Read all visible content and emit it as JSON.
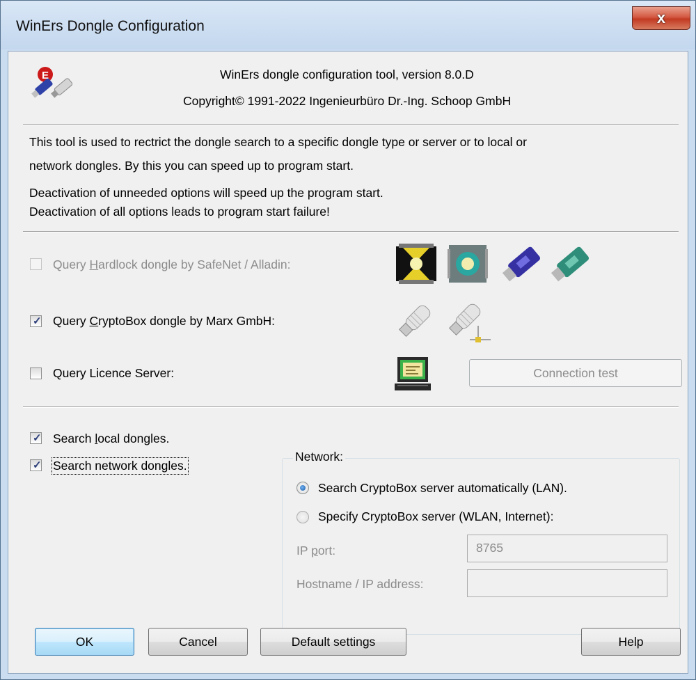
{
  "window": {
    "title": "WinErs Dongle Configuration",
    "close_glyph": "x"
  },
  "header": {
    "app_icon": "winers-dongle-logo-icon",
    "line1": "WinErs dongle configuration tool, version 8.0.D",
    "line2": "Copyright© 1991-2022 Ingenieurbüro Dr.-Ing. Schoop GmbH"
  },
  "info": {
    "para1_line1": "This tool is used to rectrict the dongle search to a specific dongle type or server or to local or",
    "para1_line2": "network dongles. By this you can speed up to program start.",
    "para2_line1": "Deactivation of unneeded options will speed up the program start.",
    "para2_line2": "Deactivation of all options leads to program start failure!"
  },
  "options": {
    "hardlock": {
      "label_pre": "Query ",
      "accel": "H",
      "label_post": "ardlock dongle by SafeNet / Alladin:",
      "checked": false,
      "enabled": false
    },
    "cryptobox": {
      "label_pre": "Query ",
      "accel": "C",
      "label_post": "ryptoBox dongle by Marx GmbH:",
      "checked": true,
      "enabled": true
    },
    "licence_server": {
      "label": "Query Licence Server:",
      "checked": false,
      "enabled": true
    },
    "connection_test": "Connection test"
  },
  "search": {
    "local": {
      "label_pre": "Search ",
      "accel": "l",
      "label_post": "ocal dongles.",
      "checked": true
    },
    "network": {
      "label": "Search network dongles.",
      "checked": true
    }
  },
  "network": {
    "group_label": "Network:",
    "radio_auto": {
      "label": "Search CryptoBox server automatically (LAN).",
      "selected": true
    },
    "radio_specify": {
      "label": "Specify CryptoBox server (WLAN, Internet):",
      "selected": false
    },
    "ip_port_pre": "IP ",
    "ip_port_accel": "p",
    "ip_port_post": "ort:",
    "ip_port_value": "8765",
    "hostname_label": "Hostname / IP address:",
    "hostname_value": ""
  },
  "buttons": {
    "ok": "OK",
    "cancel": "Cancel",
    "default_settings": "Default settings",
    "help": "Help"
  },
  "colors": {
    "check_mark": "#2c3e7a",
    "radio_dot": "#1f5fa8",
    "close_button": "#c23a22",
    "disabled_text": "#8c8c8c"
  }
}
